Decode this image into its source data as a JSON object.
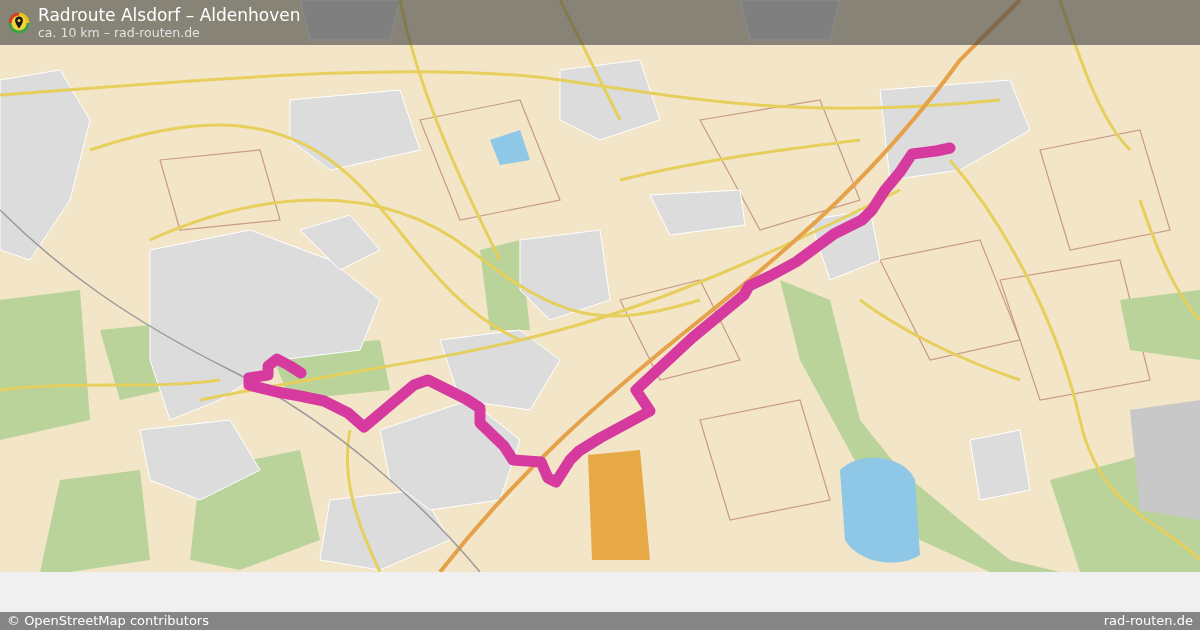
{
  "header": {
    "title": "Radroute Alsdorf – Aldenhoven",
    "subtitle": "ca. 10 km – rad-routen.de"
  },
  "footer": {
    "attribution": "© OpenStreetMap contributors",
    "site": "rad-routen.de"
  }
}
